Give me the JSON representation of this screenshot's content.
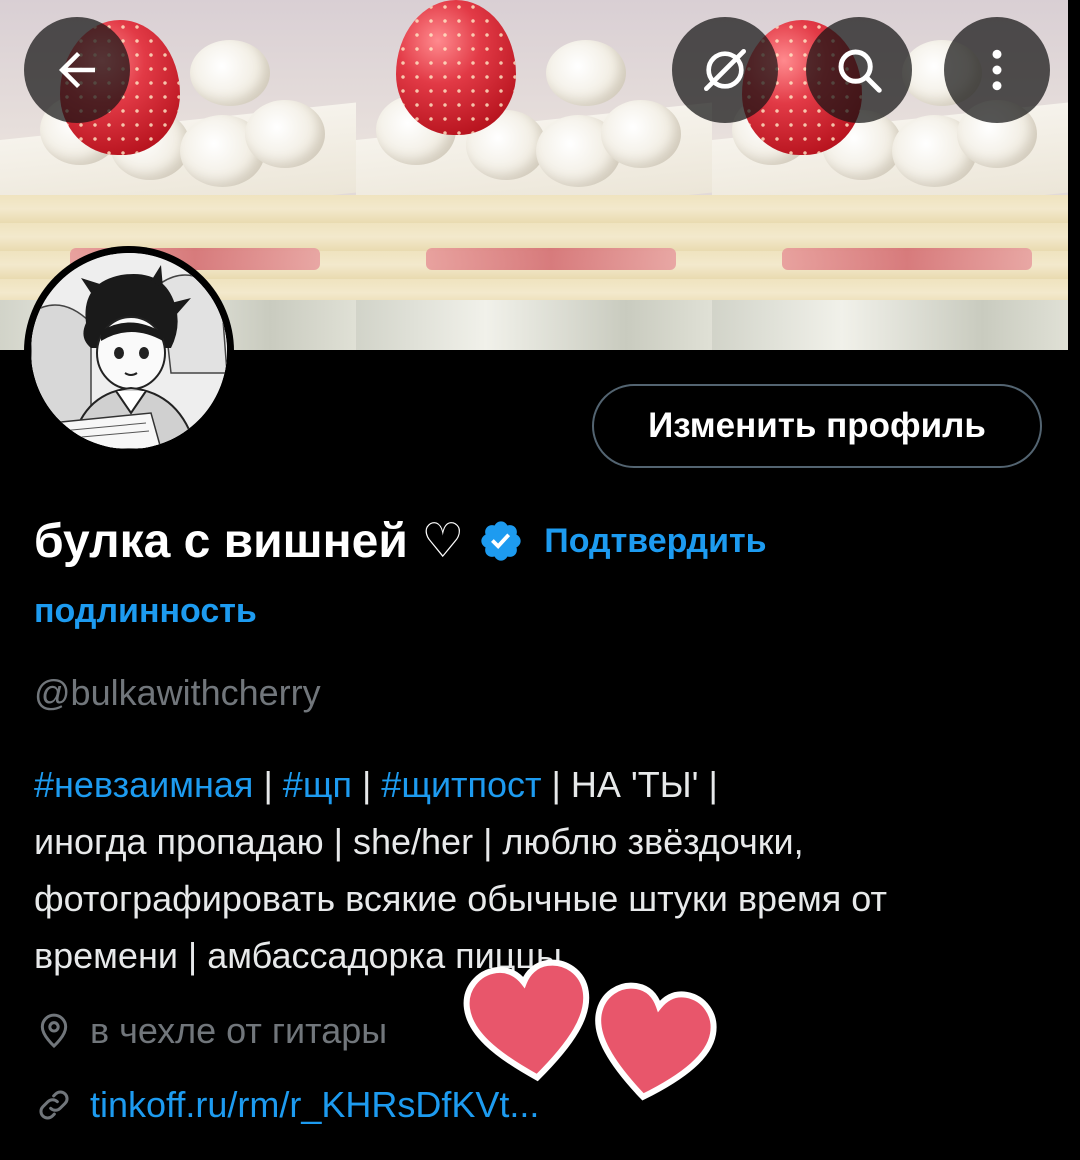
{
  "header": {
    "back_icon": "arrow-left-icon",
    "hide_icon": "eye-slash-icon",
    "search_icon": "search-icon",
    "more_icon": "more-vertical-icon"
  },
  "banner": {
    "image": "strawberry-cake-photo",
    "tiles": 3
  },
  "avatar": {
    "image": "manga-boy-avatar"
  },
  "profile": {
    "edit_button": "Изменить профиль",
    "display_name": "булка с вишней ♡",
    "verify_line1": "Подтвердить",
    "verify_line2": "подлинность",
    "handle": "@bulkawithcherry"
  },
  "bio": {
    "tag1": "#невзаимная",
    "sep1": " | ",
    "tag2": "#щп",
    "sep2": " | ",
    "tag3": "#щитпост",
    "rest_line1": " | НА 'ТЫ' |",
    "line2": "иногда пропадаю | she/her | люблю звёздочки,",
    "line3": "фотографировать всякие обычные штуки время от",
    "line4": "времени | амбассадорка пиццы"
  },
  "meta": {
    "location": "в чехле от гитары",
    "link": "tinkoff.ru/rm/r_KHRsDfKVt..."
  },
  "colors": {
    "background": "#000000",
    "accent": "#1d9bf0",
    "muted": "#71767b",
    "text": "#e7e9ea",
    "heart": "#e8566b"
  }
}
